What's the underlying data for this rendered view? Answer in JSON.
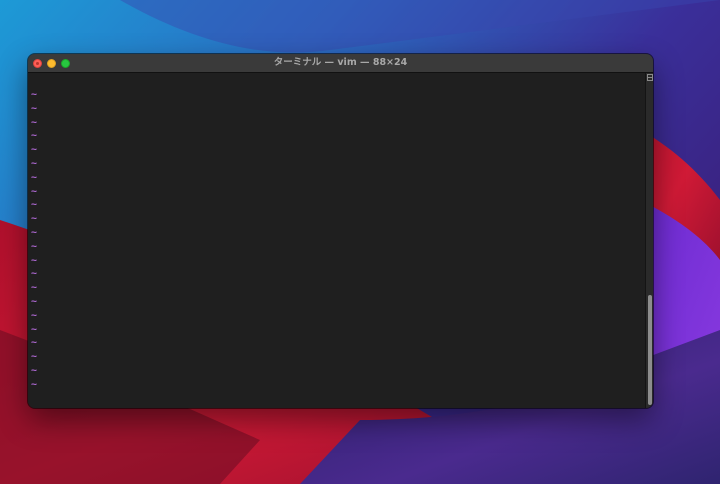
{
  "window": {
    "title": "ターミナル — vim — 88×24"
  },
  "traffic_lights": {
    "close_icon": "close-icon",
    "minimize_icon": "minimize-icon",
    "zoom_icon": "zoom-icon",
    "colors": {
      "close": "#ff5f57",
      "minimize": "#febc2e",
      "zoom": "#28c840"
    }
  },
  "terminal": {
    "background": "#1f1f1f",
    "tilde_color": "#b16ad6",
    "empty_line_markers": [
      "~",
      "~",
      "~",
      "~",
      "~",
      "~",
      "~",
      "~",
      "~",
      "~",
      "~",
      "~",
      "~",
      "~",
      "~",
      "~",
      "~",
      "~",
      "~",
      "~",
      "~",
      "~"
    ]
  },
  "scrollbar": {
    "split_icon": "split-pane-icon",
    "scroll_position": 1.0
  }
}
